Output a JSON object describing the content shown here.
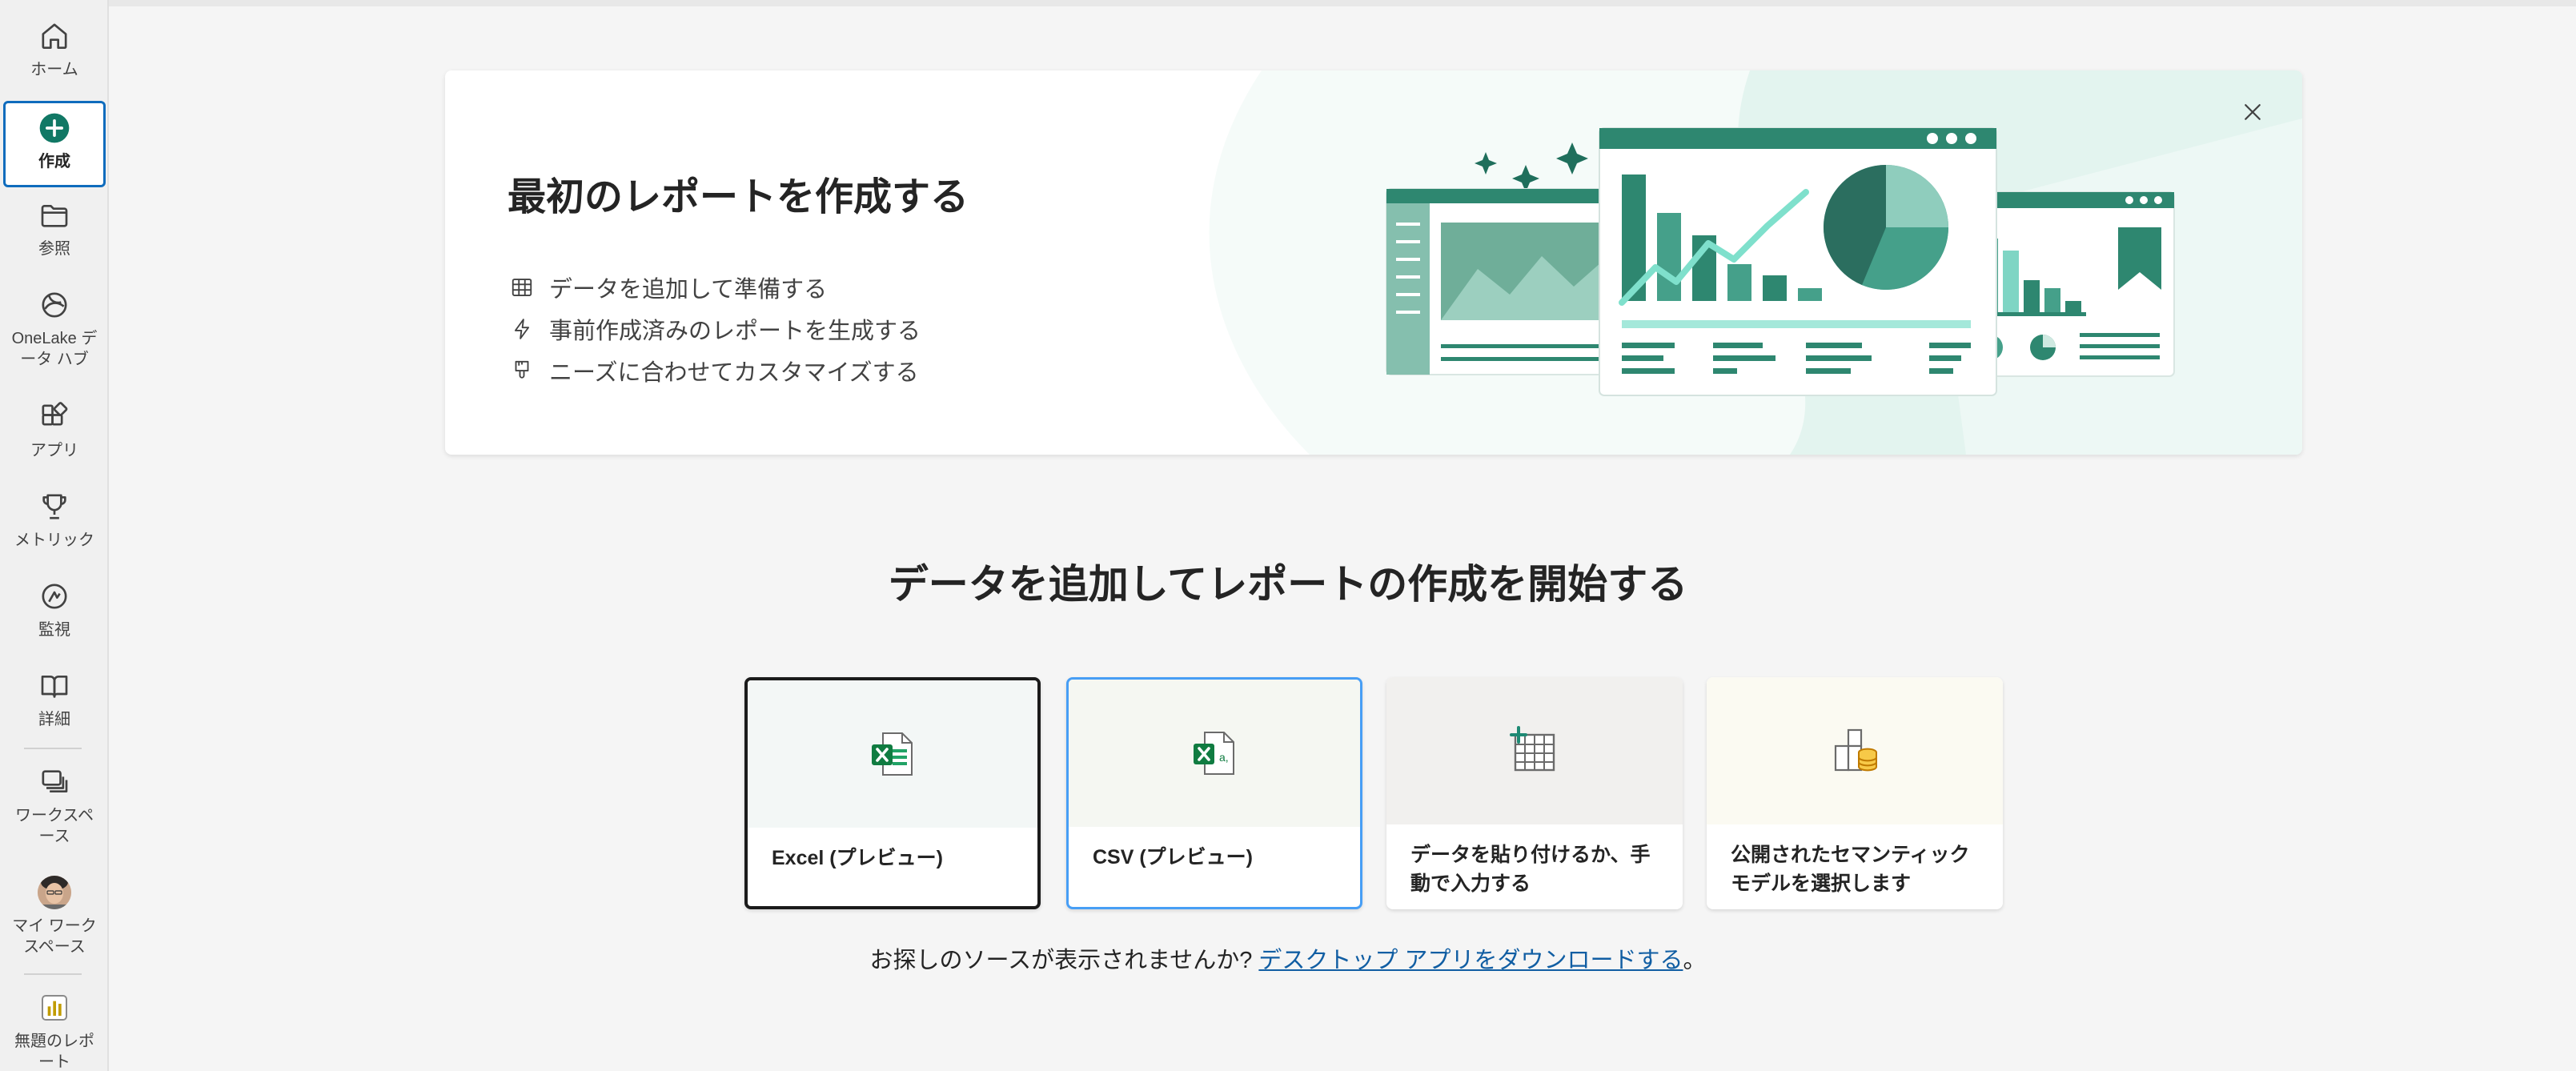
{
  "rail": {
    "items": [
      {
        "label": "ホーム",
        "icon": "home-icon"
      },
      {
        "label": "作成",
        "icon": "create-plus-icon",
        "active": true
      },
      {
        "label": "参照",
        "icon": "folder-icon"
      },
      {
        "label": "OneLake データ ハブ",
        "line1": "OneLake デ",
        "line2": "ータ ハブ",
        "icon": "onelake-icon"
      },
      {
        "label": "アプリ",
        "icon": "apps-icon"
      },
      {
        "label": "メトリック",
        "icon": "trophy-icon"
      },
      {
        "label": "監視",
        "icon": "monitor-icon"
      },
      {
        "label": "詳細",
        "icon": "book-icon"
      },
      {
        "label": "ワークスペース",
        "line1": "ワークスペ",
        "line2": "ース",
        "icon": "workspaces-icon"
      },
      {
        "label": "マイ ワークスペース",
        "line1": "マイ ワーク",
        "line2": "スペース",
        "icon": "avatar"
      },
      {
        "label": "無題のレポート",
        "line1": "無題のレポ",
        "line2": "ート",
        "icon": "report-icon"
      }
    ]
  },
  "banner": {
    "title": "最初のレポートを作成する",
    "bullets": [
      {
        "text": "データを追加して準備する",
        "icon": "table-icon"
      },
      {
        "text": "事前作成済みのレポートを生成する",
        "icon": "lightning-icon"
      },
      {
        "text": "ニーズに合わせてカスタマイズする",
        "icon": "paintbrush-icon"
      }
    ],
    "close_icon": "close-icon"
  },
  "section": {
    "title": "データを追加してレポートの作成を開始する",
    "cards": [
      {
        "label": "Excel (プレビュー)",
        "icon": "excel-icon",
        "bg": "#f3f7f6"
      },
      {
        "label": "CSV (プレビュー)",
        "icon": "csv-icon",
        "bg": "#f5f7f2"
      },
      {
        "label": "データを貼り付けるか、手動で入力する",
        "line1": "データを貼り付けるか、手",
        "line2": "動で入力する",
        "icon": "table-add-icon",
        "bg": "#f1f0ee"
      },
      {
        "label": "公開されたセマンティックモデルを選択します",
        "line1": "公開されたセマンティック",
        "line2": "モデルを選択します",
        "icon": "semantic-model-icon",
        "bg": "#fbfaf2"
      }
    ]
  },
  "footer": {
    "text": "お探しのソースが表示されませんか? ",
    "link": "デスクトップ アプリをダウンロードする",
    "end": "。"
  },
  "colors": {
    "accent_teal": "#1e8a74",
    "selection_blue": "#0f6cbd",
    "link": "#115ea3"
  }
}
